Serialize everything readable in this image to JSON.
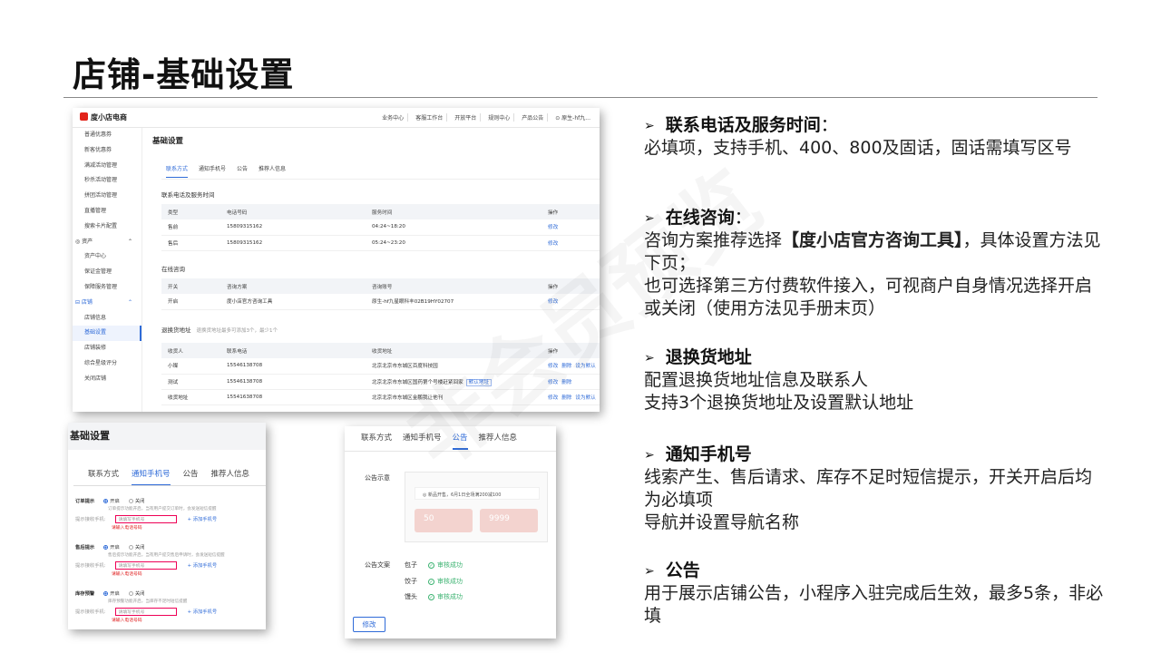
{
  "title": "店铺-基础设置",
  "watermark": "非会员预览",
  "main_shot": {
    "logo": "度小店电商",
    "topnav": [
      "业务中心",
      "客服工作台",
      "开放平台",
      "规则中心",
      "产品公告",
      "⊙ 原生-hf九..."
    ],
    "sidebar": [
      {
        "label": "普通优惠券",
        "type": "item"
      },
      {
        "label": "新客优惠券",
        "type": "item"
      },
      {
        "label": "满减活动管理",
        "type": "item"
      },
      {
        "label": "秒杀活动管理",
        "type": "item"
      },
      {
        "label": "拼团活动管理",
        "type": "item"
      },
      {
        "label": "直播管理",
        "type": "item"
      },
      {
        "label": "搜索卡片配置",
        "type": "item"
      },
      {
        "label": "◎ 资产",
        "type": "group"
      },
      {
        "label": "资产中心",
        "type": "item"
      },
      {
        "label": "保证金管理",
        "type": "item"
      },
      {
        "label": "保障服务管理",
        "type": "item"
      },
      {
        "label": "⊟ 店铺",
        "type": "group-blue"
      },
      {
        "label": "店铺信息",
        "type": "item"
      },
      {
        "label": "基础设置",
        "type": "active"
      },
      {
        "label": "店铺装修",
        "type": "item"
      },
      {
        "label": "综合星级评分",
        "type": "item"
      },
      {
        "label": "关闭店铺",
        "type": "item"
      }
    ],
    "panel_title": "基础设置",
    "tabs": [
      "联系方式",
      "通知手机号",
      "公告",
      "推荐人信息"
    ],
    "contact_section": "联系电话及服务时间",
    "contact_headers": [
      "类型",
      "电话号码",
      "服务时间",
      "操作"
    ],
    "contact_rows": [
      [
        "售前",
        "15809315162",
        "04:24~18:20",
        "修改"
      ],
      [
        "售后",
        "15809315162",
        "05:24~23:20",
        "修改"
      ]
    ],
    "consult_section": "在线咨询",
    "consult_headers": [
      "开关",
      "咨询方案",
      "咨询账号",
      "操作"
    ],
    "consult_rows": [
      [
        "开启",
        "度小店官方咨询工具",
        "原生-hf九星眼科丰02B19HY02707",
        "修改"
      ]
    ],
    "return_section": "退换货地址",
    "return_note": "退换货地址最多可添加3个，最少1个",
    "return_headers": [
      "收货人",
      "联系电话",
      "收货地址",
      "操作"
    ],
    "return_rows": [
      {
        "name": "小璨",
        "phone": "15546138708",
        "addr": "北京北京市东城区百度科技园",
        "tag": "",
        "ops": [
          "修改",
          "删除",
          "设为默认"
        ]
      },
      {
        "name": "测试",
        "phone": "15546138708",
        "addr": "北京北京市东城区国药第个号楼赶紧回家",
        "tag": "默认地址",
        "ops": [
          "修改",
          "删除"
        ]
      },
      {
        "name": "收货地址",
        "phone": "15541638708",
        "addr": "北京北京市东城区金鹏我让他刊",
        "tag": "",
        "ops": [
          "修改",
          "删除",
          "设为默认"
        ]
      }
    ]
  },
  "bl_shot": {
    "header": "基础设置",
    "tabs": [
      "联系方式",
      "通知手机号",
      "公告",
      "推荐人信息"
    ],
    "groups": [
      {
        "title": "订单提示",
        "on": "开启",
        "off": "关闭",
        "desc": "订单提示功能开启，当有用户提交订单时，会发送短信提醒",
        "phone_label": "提示接收手机:",
        "placeholder": "请填写手机号",
        "add": "+ 添加手机号",
        "error": "请输入电话号码"
      },
      {
        "title": "售后提示",
        "on": "开启",
        "off": "关闭",
        "desc": "售后提示功能开启，当有用户提交售后申请时，会发送短信提醒",
        "phone_label": "提示接收手机:",
        "placeholder": "请填写手机号",
        "add": "+ 添加手机号",
        "error": "请输入电话号码"
      },
      {
        "title": "库存预警",
        "on": "开启",
        "off": "关闭",
        "desc": "库存预警功能开启，当库存不足时短信提醒",
        "phone_label": "提示接收手机:",
        "placeholder": "请填写手机号",
        "add": "+ 添加手机号",
        "error": "请输入电话号码"
      }
    ]
  },
  "bm_shot": {
    "tabs": [
      "联系方式",
      "通知手机号",
      "公告",
      "推荐人信息"
    ],
    "preview_label": "公告示意",
    "preview_bar": "◎ 新品开售，6月1日全场满200减100",
    "preview_cards": [
      "50",
      "9999"
    ],
    "copy_label": "公告文案",
    "items": [
      {
        "name": "包子",
        "status": "审核成功"
      },
      {
        "name": "饺子",
        "status": "审核成功"
      },
      {
        "name": "馒头",
        "status": "审核成功"
      }
    ],
    "edit": "修改"
  },
  "right": [
    {
      "heading": "联系电话及服务时间",
      "colon": "：",
      "lines": [
        "必填项，支持手机、400、800及固话，固话需填写区号"
      ]
    },
    {
      "heading": "在线咨询",
      "colon": "：",
      "lines": [
        "咨询方案推荐选择",
        "【度小店官方咨询工具】",
        "，具体设置方法见下页；",
        "也可选择第三方付费软件接入，可视商户自身情况选择开启或关闭（使用方法见手册末页）"
      ]
    },
    {
      "heading": "退换货地址",
      "colon": "",
      "lines": [
        "配置退换货地址信息及联系人",
        "支持3个退换货地址及设置默认地址"
      ]
    },
    {
      "heading": "通知手机号",
      "colon": "",
      "lines": [
        "线索产生、售后请求、库存不足时短信提示，开关开启后均为必填项",
        "导航并设置导航名称"
      ]
    },
    {
      "heading": "公告",
      "colon": "",
      "lines": [
        "用于展示店铺公告，小程序入驻完成后生效，最多5条，非必填"
      ]
    }
  ]
}
